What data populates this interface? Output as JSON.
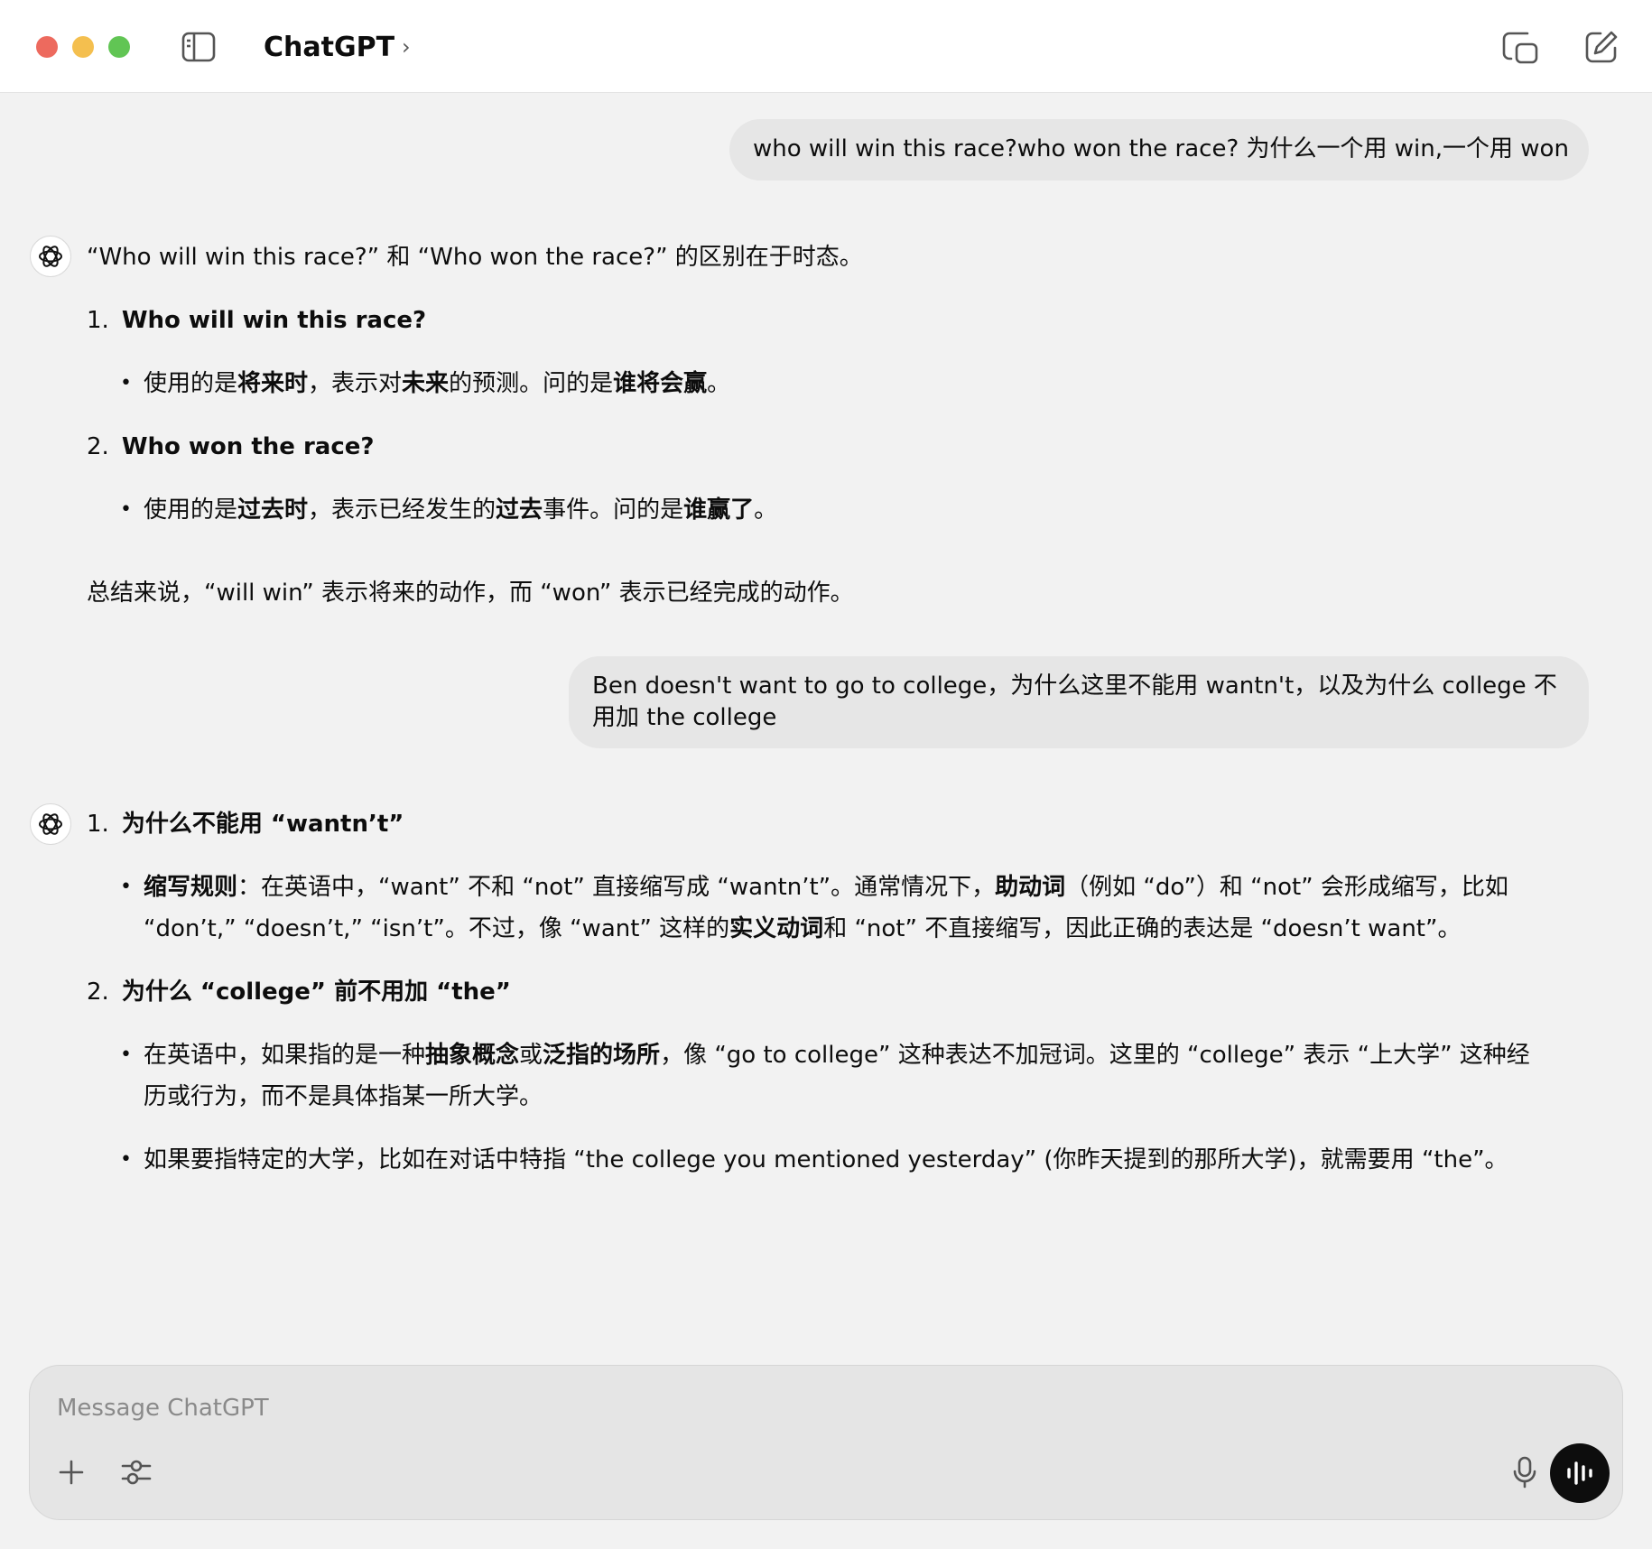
{
  "header": {
    "title": "ChatGPT",
    "chevron": "›"
  },
  "messages": {
    "user1": "who will win this race?who won the race? 为什么一个用 win,一个用 won",
    "resp1": {
      "intro": "“Who will win this race?” 和 “Who won the race?” 的区别在于时态。",
      "item1_num": "1.",
      "item1_title": "Who will win this race?",
      "item1_b1": "使用的是",
      "item1_b2": "将来时",
      "item1_b3": "，表示对",
      "item1_b4": "未来",
      "item1_b5": "的预测。问的是",
      "item1_b6": "谁将会赢",
      "item1_b7": "。",
      "item2_num": "2.",
      "item2_title": "Who won the race?",
      "item2_b1": "使用的是",
      "item2_b2": "过去时",
      "item2_b3": "，表示已经发生的",
      "item2_b4": "过去",
      "item2_b5": "事件。问的是",
      "item2_b6": "谁赢了",
      "item2_b7": "。",
      "summary": "总结来说，“will win” 表示将来的动作，而 “won” 表示已经完成的动作。"
    },
    "user2": "Ben doesn't want to go to college，为什么这里不能用 wantn't，以及为什么 college 不用加 the college",
    "resp2": {
      "item1_num": "1.",
      "item1_title": "为什么不能用 “wantn’t”",
      "item1_b1": "缩写规则",
      "item1_b2": "：在英语中，“want” 不和 “not” 直接缩写成 “wantn’t”。通常情况下，",
      "item1_b3": "助动词",
      "item1_b4": "（例如 “do”）和 “not” 会形成缩写，比如 “don’t,” “doesn’t,” “isn’t”。不过，像 “want” 这样的",
      "item1_b5": "实义动词",
      "item1_b6": "和 “not” 不直接缩写，因此正确的表达是 “doesn’t want”。",
      "item2_num": "2.",
      "item2_title": "为什么 “college” 前不用加 “the”",
      "item2_p1a": "在英语中，如果指的是一种",
      "item2_p1b": "抽象概念",
      "item2_p1c": "或",
      "item2_p1d": "泛指的场所",
      "item2_p1e": "，像 “go to college” 这种表达不加冠词。这里的 “college” 表示 “上大学” 这种经历或行为，而不是具体指某一所大学。",
      "item2_p2": "如果要指特定的大学，比如在对话中特指 “the college you mentioned yesterday” (你昨天提到的那所大学)，就需要用 “the”。"
    }
  },
  "composer": {
    "placeholder": "Message ChatGPT"
  },
  "bullet": "•",
  "icons": [
    "sidebar-toggle-icon",
    "window-icon",
    "new-chat-icon",
    "openai-logo-icon",
    "plus-icon",
    "tools-sliders-icon",
    "microphone-icon",
    "voice-wave-icon"
  ]
}
